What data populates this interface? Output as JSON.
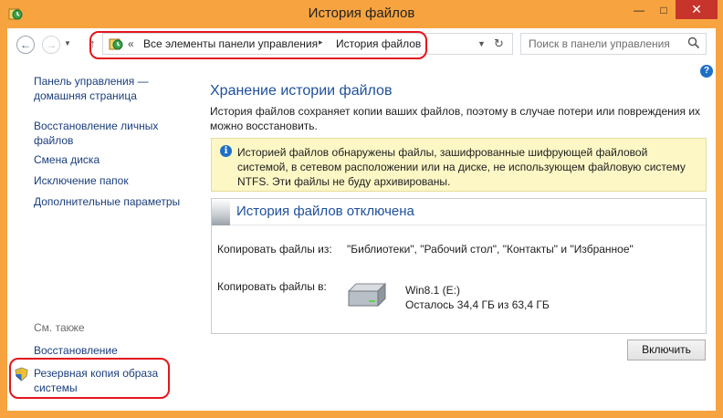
{
  "window": {
    "title": "История файлов",
    "icons": {
      "app": "file-history-icon",
      "minimize": "minimize-icon",
      "maximize": "maximize-icon",
      "close": "close-icon"
    }
  },
  "navbar": {
    "breadcrumb_chevron": "«",
    "breadcrumb": [
      "Все элементы панели управления",
      "История файлов"
    ],
    "breadcrumb_separator": "▸",
    "search_placeholder": "Поиск в панели управления"
  },
  "sidebar": {
    "links": [
      "Панель управления — домашняя страница",
      "Восстановление личных файлов",
      "Смена диска",
      "Исключение папок",
      "Дополнительные параметры"
    ],
    "see_also_label": "См. также",
    "see_also": [
      "Восстановление",
      "Резервная копия образа системы"
    ]
  },
  "main": {
    "title": "Хранение истории файлов",
    "description": "История файлов сохраняет копии ваших файлов, поэтому в случае потери или повреждения их можно восстановить.",
    "warning": "Историей файлов обнаружены файлы, зашифрованные шифрующей файловой системой, в сетевом расположении или на диске, не использующем файловую систему NTFS. Эти файлы не буду архивированы.",
    "panel": {
      "title": "История файлов отключена",
      "copy_from_label": "Копировать файлы из:",
      "copy_from_value": "\"Библиотеки\", \"Рабочий стол\", \"Контакты\" и \"Избранное\"",
      "copy_to_label": "Копировать файлы в:",
      "drive_name": "Win8.1 (E:)",
      "drive_space": "Осталось 34,4 ГБ из 63,4 ГБ"
    },
    "enable_button": "Включить"
  },
  "colors": {
    "frame": "#f7a440",
    "link": "#1a3e7c",
    "heading": "#1e4f9c",
    "warning_bg": "#fcf7c5",
    "highlight": "#e3161c",
    "close": "#c7342b"
  }
}
